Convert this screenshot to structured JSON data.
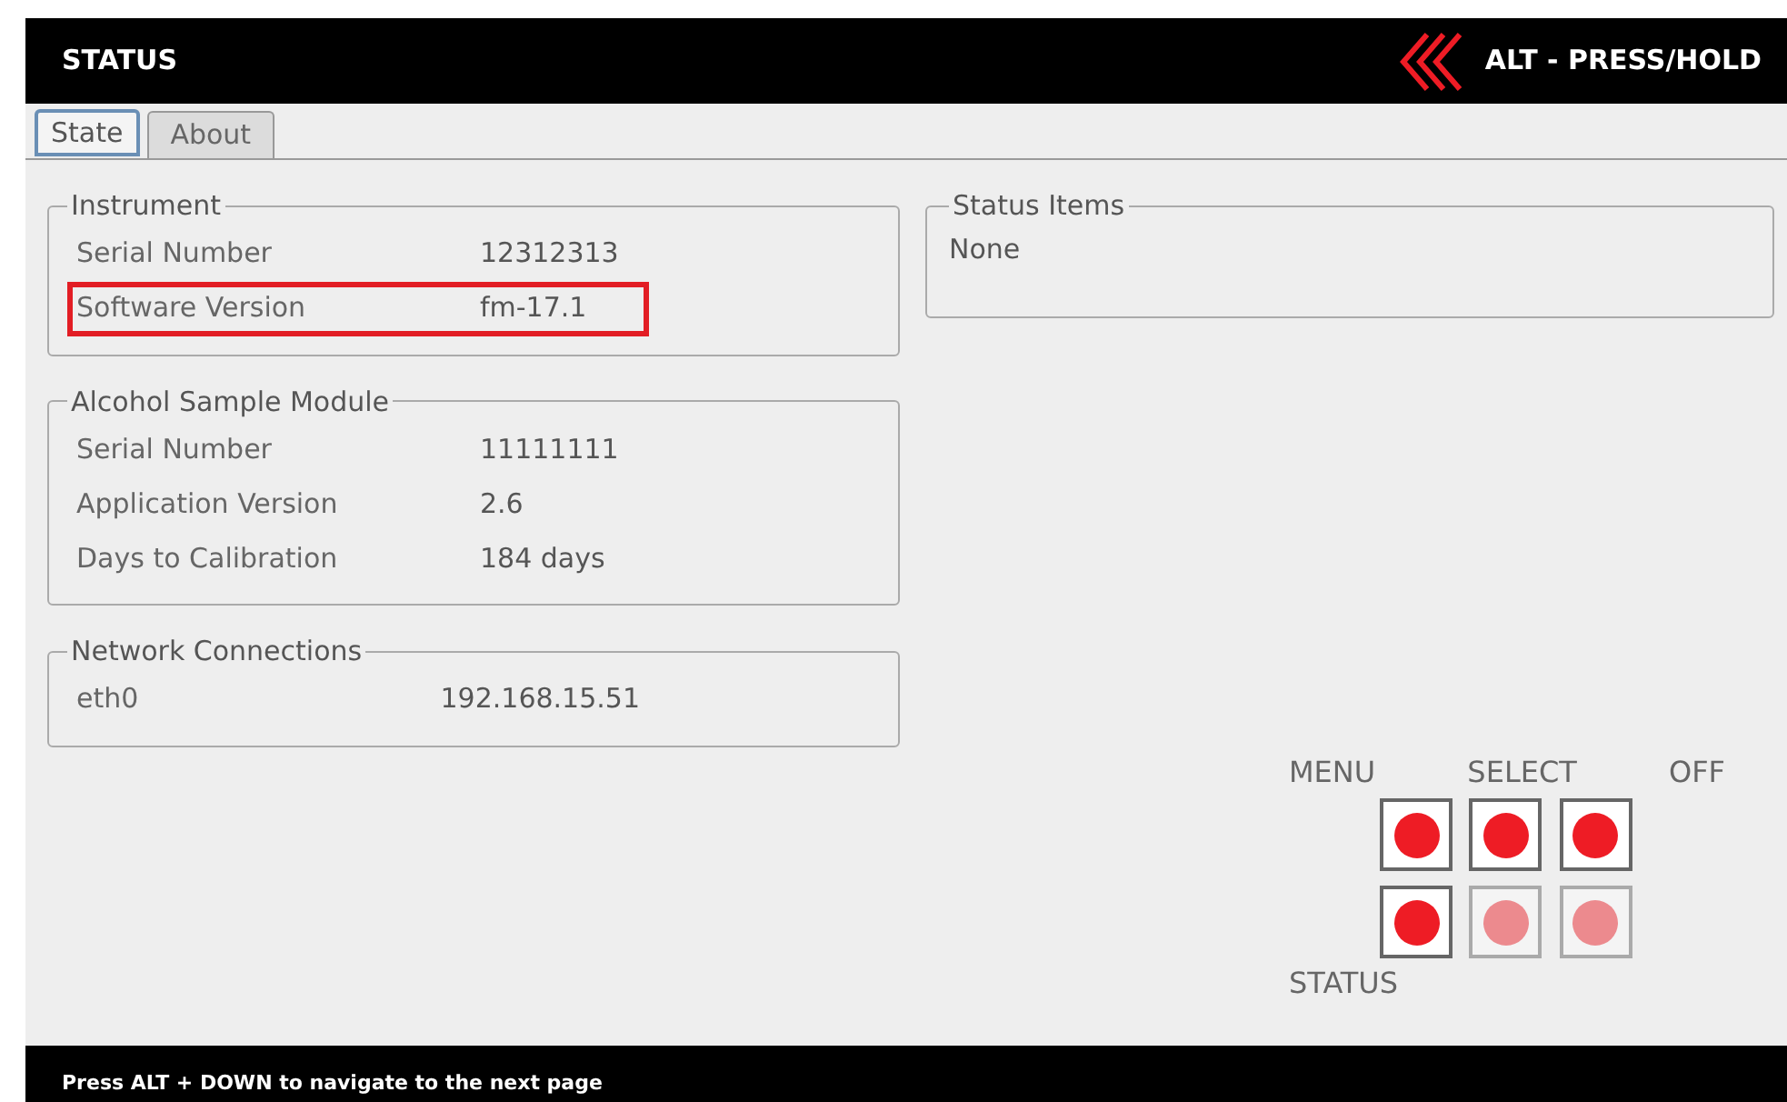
{
  "header": {
    "title": "STATUS",
    "hint": "ALT - PRESS/HOLD"
  },
  "tabs": [
    {
      "label": "State",
      "selected": true
    },
    {
      "label": "About",
      "selected": false
    }
  ],
  "groups": [
    {
      "title": "Instrument",
      "rows": [
        {
          "label": "Serial Number",
          "value": "12312313",
          "highlighted": false
        },
        {
          "label": "Software Version",
          "value": "fm-17.1",
          "highlighted": true
        }
      ]
    },
    {
      "title": "Alcohol Sample Module",
      "rows": [
        {
          "label": "Serial Number",
          "value": "11111111",
          "highlighted": false
        },
        {
          "label": "Application Version",
          "value": "2.6",
          "highlighted": false
        },
        {
          "label": "Days to Calibration",
          "value": "184 days",
          "highlighted": false
        }
      ]
    },
    {
      "title": "Network Connections",
      "rows": [
        {
          "label": "eth0",
          "value": "192.168.15.51",
          "highlighted": false
        }
      ]
    }
  ],
  "status_items": {
    "title": "Status Items",
    "text": "None"
  },
  "keypad": {
    "top_labels": [
      "MENU",
      "SELECT",
      "OFF"
    ],
    "bottom_label": "STATUS",
    "keys": [
      {
        "on": true
      },
      {
        "on": true
      },
      {
        "on": true
      },
      {
        "on": true
      },
      {
        "on": false
      },
      {
        "on": false
      }
    ]
  },
  "footer": "Press ALT + DOWN to navigate to the next page"
}
